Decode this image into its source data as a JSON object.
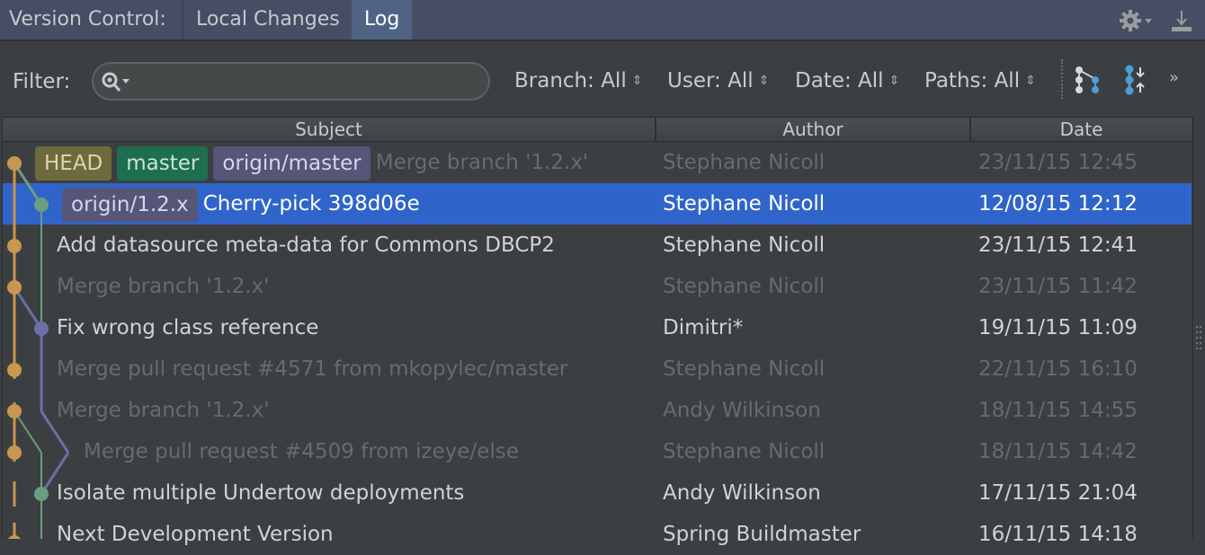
{
  "topbar": {
    "title": "Version Control:",
    "tabs": [
      {
        "label": "Local Changes",
        "active": false
      },
      {
        "label": "Log",
        "active": true
      }
    ],
    "icons": [
      "gear-icon",
      "download-icon"
    ]
  },
  "filter": {
    "label": "Filter:",
    "search": {
      "value": "",
      "placeholder": ""
    },
    "dropdowns": [
      {
        "label": "Branch: All"
      },
      {
        "label": "User: All"
      },
      {
        "label": "Date: All"
      },
      {
        "label": "Paths: All"
      }
    ],
    "toolbar_icons": [
      "branch-graph-icon",
      "collapse-expand-icon",
      "more-icon"
    ],
    "more_label": "»"
  },
  "table": {
    "columns": [
      "Subject",
      "Author",
      "Date"
    ],
    "rows": [
      {
        "tags": [
          "HEAD",
          "master",
          "origin/master"
        ],
        "subject": "Merge branch '1.2.x'",
        "author": "Stephane Nicoll",
        "date": "23/11/15 12:45",
        "dim": true,
        "selected": false
      },
      {
        "tags": [
          "origin/1.2.x"
        ],
        "subject": "Cherry-pick 398d06e",
        "author": "Stephane Nicoll",
        "date": "12/08/15 12:12",
        "dim": false,
        "selected": true
      },
      {
        "tags": [],
        "subject": "Add datasource meta-data for Commons DBCP2",
        "author": "Stephane Nicoll",
        "date": "23/11/15 12:41",
        "dim": false,
        "selected": false
      },
      {
        "tags": [],
        "subject": "Merge branch '1.2.x'",
        "author": "Stephane Nicoll",
        "date": "23/11/15 11:42",
        "dim": true,
        "selected": false
      },
      {
        "tags": [],
        "subject": "Fix wrong class reference",
        "author": "Dimitri*",
        "date": "19/11/15 11:09",
        "dim": false,
        "selected": false
      },
      {
        "tags": [],
        "subject": "Merge pull request #4571 from mkopylec/master",
        "author": "Stephane Nicoll",
        "date": "22/11/15 16:10",
        "dim": true,
        "selected": false
      },
      {
        "tags": [],
        "subject": "Merge branch '1.2.x'",
        "author": "Andy Wilkinson",
        "date": "18/11/15 14:55",
        "dim": true,
        "selected": false
      },
      {
        "tags": [],
        "subject": "Merge pull request #4509 from izeye/else",
        "author": "Stephane Nicoll",
        "date": "18/11/15 14:42",
        "dim": true,
        "selected": false
      },
      {
        "tags": [],
        "subject": "Isolate multiple Undertow deployments",
        "author": "Andy Wilkinson",
        "date": "17/11/15 21:04",
        "dim": false,
        "selected": false
      },
      {
        "tags": [],
        "subject": "Next Development Version",
        "author": "Spring Buildmaster",
        "date": "16/11/15 14:18",
        "dim": false,
        "selected": false
      }
    ]
  },
  "colors": {
    "selection": "#2f65ca",
    "graph_master": "#c9974f",
    "graph_branch_green": "#6a9e7e",
    "graph_branch_purple": "#6b6fa6",
    "tag_head": "#6e6a3b",
    "tag_master": "#1d6f4f",
    "tag_origin": "#555678"
  }
}
